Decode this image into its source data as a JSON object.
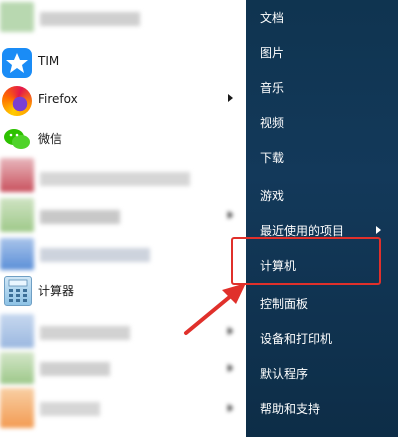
{
  "left_panel": {
    "items": [
      {
        "label": "TIM",
        "icon": "tim-icon",
        "has_submenu": false
      },
      {
        "label": "Firefox",
        "icon": "firefox-icon",
        "has_submenu": true
      },
      {
        "label": "微信",
        "icon": "wechat-icon",
        "has_submenu": false
      },
      {
        "label": "计算器",
        "icon": "calculator-icon",
        "has_submenu": false
      }
    ]
  },
  "right_panel": {
    "items": [
      {
        "label": "文档"
      },
      {
        "label": "图片"
      },
      {
        "label": "音乐"
      },
      {
        "label": "视频"
      },
      {
        "label": "下载"
      },
      {
        "label": "游戏"
      },
      {
        "label": "最近使用的项目",
        "has_submenu": true
      },
      {
        "label": "计算机",
        "highlighted": true
      },
      {
        "label": "控制面板"
      },
      {
        "label": "设备和打印机"
      },
      {
        "label": "默认程序"
      },
      {
        "label": "帮助和支持"
      }
    ]
  },
  "colors": {
    "right_bg": "#13395a",
    "highlight": "#e0302b"
  }
}
